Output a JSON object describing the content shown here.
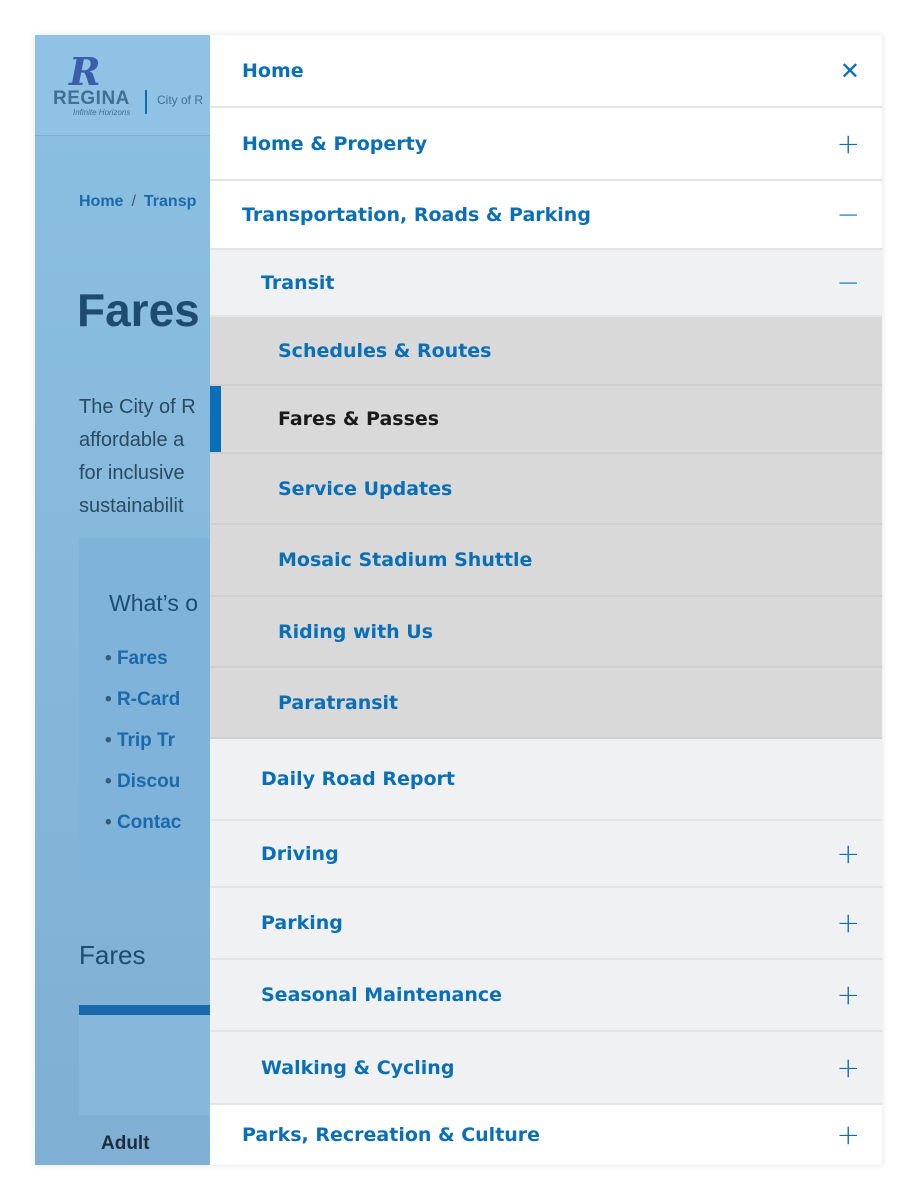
{
  "background_page": {
    "logo": {
      "name": "REGINA",
      "tagline": "Infinite Horizons",
      "city": "City of R"
    },
    "breadcrumb": [
      "Home",
      "Transp"
    ],
    "title": "Fares",
    "intro": "The City of R affordable a for inclusive sustainabilit",
    "toc": {
      "title": "What’s o",
      "items": [
        "Fares",
        "R-Card",
        "Trip Tr",
        "Discou",
        "Contac"
      ]
    },
    "section_title": "Fares",
    "table_first_row": "Adult"
  },
  "menu": {
    "items": [
      {
        "label": "Home",
        "level": 1,
        "icon": "close-icon"
      },
      {
        "label": "Home & Property",
        "level": 1,
        "icon": "plus-icon"
      },
      {
        "label": "Transportation, Roads & Parking",
        "level": 1,
        "icon": "minus-icon"
      },
      {
        "label": "Transit",
        "level": 2,
        "icon": "minus-icon"
      },
      {
        "label": "Schedules & Routes",
        "level": 3
      },
      {
        "label": "Fares & Passes",
        "level": 3,
        "active": true
      },
      {
        "label": "Service Updates",
        "level": 3
      },
      {
        "label": "Mosaic Stadium Shuttle",
        "level": 3
      },
      {
        "label": "Riding with Us",
        "level": 3
      },
      {
        "label": "Paratransit",
        "level": 3
      },
      {
        "label": "Daily Road Report",
        "level": 2
      },
      {
        "label": "Driving",
        "level": 2,
        "icon": "plus-icon"
      },
      {
        "label": "Parking",
        "level": 2,
        "icon": "plus-icon"
      },
      {
        "label": "Seasonal Maintenance",
        "level": 2,
        "icon": "plus-icon"
      },
      {
        "label": "Walking & Cycling",
        "level": 2,
        "icon": "plus-icon"
      },
      {
        "label": "Parks, Recreation & Culture",
        "level": 1,
        "icon": "plus-icon"
      }
    ]
  },
  "colors": {
    "accent": "#0a6fb5",
    "overlay": "#8bbde0",
    "submenu_bg": "#d9d9d9",
    "level2_bg": "#f0f1f2"
  }
}
